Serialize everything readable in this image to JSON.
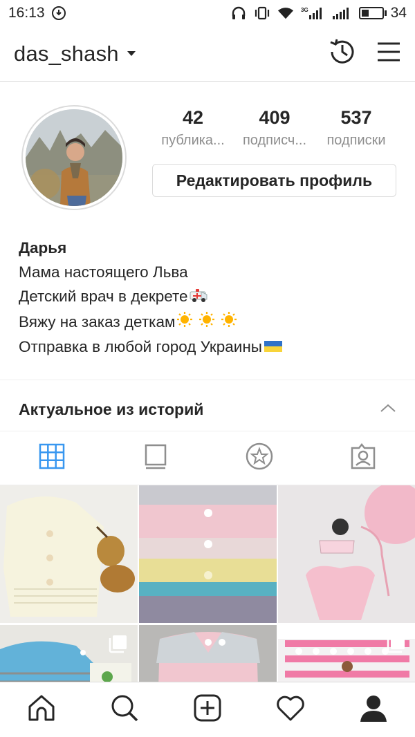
{
  "status_bar": {
    "time": "16:13",
    "battery": "34",
    "battery_level": 0.34,
    "network_type": "3G",
    "icons": [
      "download-icon",
      "headphones-icon",
      "vibrate-icon",
      "wifi-icon",
      "signal-icon",
      "signal-icon",
      "battery-icon"
    ]
  },
  "header": {
    "username": "das_shash",
    "icons": [
      "chevron-down-icon",
      "history-icon",
      "menu-icon"
    ]
  },
  "stats": [
    {
      "value": "42",
      "label": "публика..."
    },
    {
      "value": "409",
      "label": "подписч..."
    },
    {
      "value": "537",
      "label": "подписки"
    }
  ],
  "edit_profile_label": "Редактировать профиль",
  "bio": {
    "name": "Дарья",
    "lines": [
      {
        "text": "Мама настоящего Льва",
        "emoji": ""
      },
      {
        "text": "Детский врач в декрете",
        "emoji": "ambulance-emoji"
      },
      {
        "text": "Вяжу на заказ деткам",
        "emoji": "sun-emoji-x3"
      },
      {
        "text": "Отправка в любой город Украины",
        "emoji": "ukraine-flag-emoji"
      }
    ]
  },
  "highlights": {
    "title": "Актуальное из историй"
  },
  "tabs": [
    "grid-icon",
    "feed-icon",
    "saved-icon",
    "tagged-icon"
  ],
  "colors": {
    "accent": "#3897f0",
    "text": "#262626",
    "secondary": "#8e8e8e",
    "border": "#dbdbdb"
  },
  "bottom_nav": [
    "home-icon",
    "search-icon",
    "add-icon",
    "heart-icon",
    "profile-icon"
  ]
}
